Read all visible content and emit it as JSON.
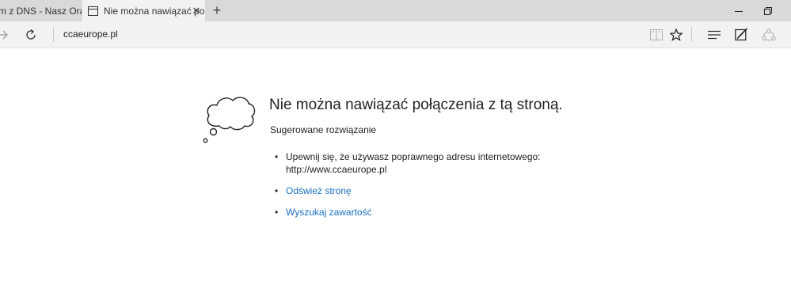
{
  "tabs": {
    "inactive": {
      "title": "m z DNS - Nasz Oran"
    },
    "active": {
      "title": "Nie można nawiązać po",
      "close_glyph": "✕"
    },
    "new_tab_glyph": "+"
  },
  "address_bar": {
    "url": "ccaeurope.pl"
  },
  "error_page": {
    "title": "Nie można nawiązać połączenia z tą stroną.",
    "subtitle": "Sugerowane rozwiązanie",
    "suggestion_line1": "Upewnij się, że używasz poprawnego adresu internetowego:",
    "suggestion_line2": "http://www.ccaeurope.pl",
    "refresh_link": "Odśwież stronę",
    "search_link": "Wyszukaj zawartość"
  },
  "colors": {
    "tab_bar": "#d9d9d9",
    "nav_bar": "#f2f2f2",
    "link": "#1a6fc1"
  }
}
